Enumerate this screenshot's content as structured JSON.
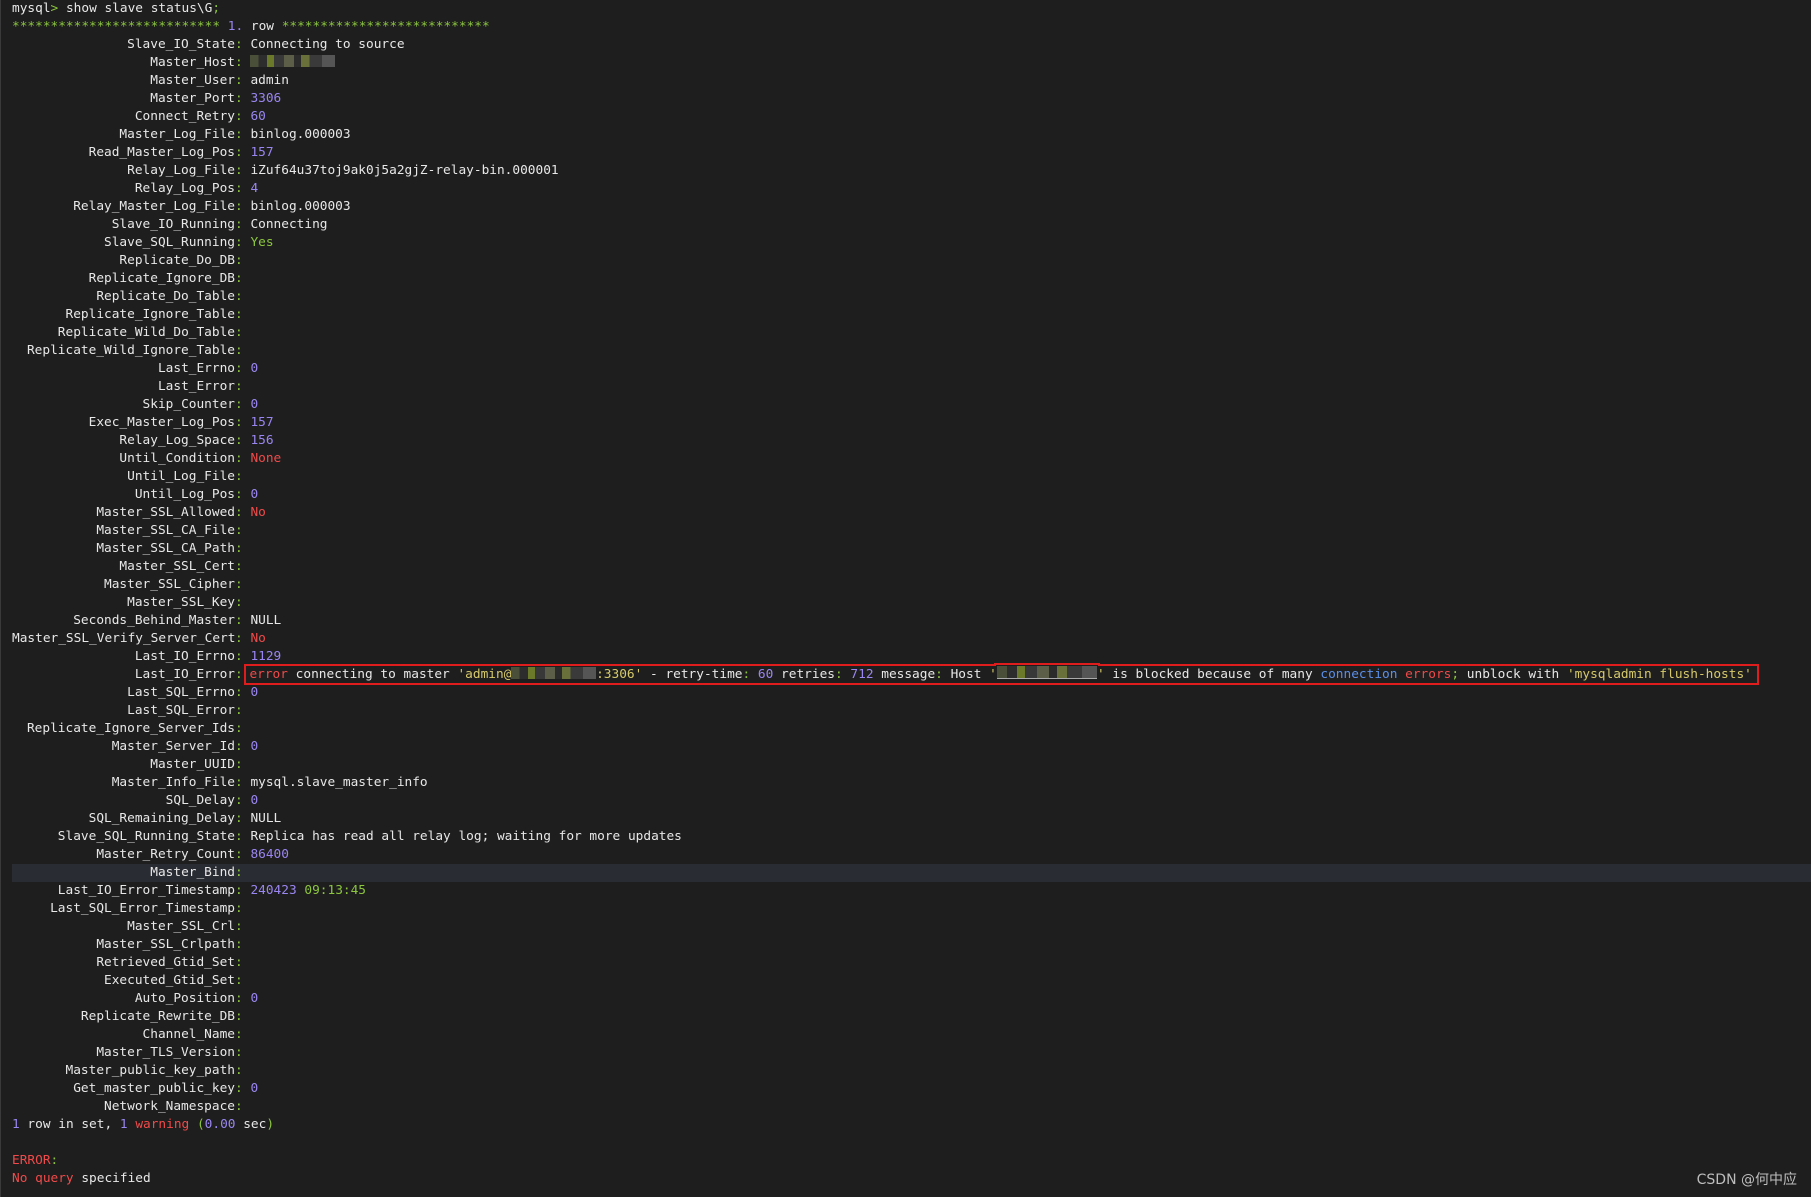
{
  "colors": {
    "background": "#1e1e1e",
    "text": "#e8e8e8",
    "number": "#9a86f0",
    "punct": "#8cc63f",
    "red": "#f04a4a",
    "string": "#d6c96a",
    "blue": "#5b8fe8",
    "error_box": "#e01d1d"
  },
  "prompt": [
    {
      "t": "mysql",
      "c": "w"
    },
    {
      "t": ">",
      "c": "g"
    },
    {
      "t": " show slave status\\G",
      "c": "w"
    },
    {
      "t": ";",
      "c": "g"
    }
  ],
  "row_header": [
    {
      "t": "***************************",
      "c": "g"
    },
    {
      "t": " 1.",
      "c": "n"
    },
    {
      "t": " row ",
      "c": "w"
    },
    {
      "t": "***************************",
      "c": "g"
    }
  ],
  "fields": [
    {
      "k": "Slave_IO_State",
      "v": [
        {
          "t": "Connecting to source",
          "c": "w"
        }
      ]
    },
    {
      "k": "Master_Host",
      "v": [
        {
          "mask": 11
        }
      ]
    },
    {
      "k": "Master_User",
      "v": [
        {
          "t": "admin",
          "c": "w"
        }
      ]
    },
    {
      "k": "Master_Port",
      "v": [
        {
          "t": "3306",
          "c": "n"
        }
      ]
    },
    {
      "k": "Connect_Retry",
      "v": [
        {
          "t": "60",
          "c": "n"
        }
      ]
    },
    {
      "k": "Master_Log_File",
      "v": [
        {
          "t": "binlog.000003",
          "c": "w"
        }
      ]
    },
    {
      "k": "Read_Master_Log_Pos",
      "v": [
        {
          "t": "157",
          "c": "n"
        }
      ]
    },
    {
      "k": "Relay_Log_File",
      "v": [
        {
          "t": "iZuf64u37toj9ak0j5a2gjZ-relay-bin.000001",
          "c": "w"
        }
      ]
    },
    {
      "k": "Relay_Log_Pos",
      "v": [
        {
          "t": "4",
          "c": "n"
        }
      ]
    },
    {
      "k": "Relay_Master_Log_File",
      "v": [
        {
          "t": "binlog.000003",
          "c": "w"
        }
      ]
    },
    {
      "k": "Slave_IO_Running",
      "v": [
        {
          "t": "Connecting",
          "c": "w"
        }
      ]
    },
    {
      "k": "Slave_SQL_Running",
      "v": [
        {
          "t": "Yes",
          "c": "g"
        }
      ]
    },
    {
      "k": "Replicate_Do_DB",
      "v": []
    },
    {
      "k": "Replicate_Ignore_DB",
      "v": []
    },
    {
      "k": "Replicate_Do_Table",
      "v": []
    },
    {
      "k": "Replicate_Ignore_Table",
      "v": []
    },
    {
      "k": "Replicate_Wild_Do_Table",
      "v": []
    },
    {
      "k": "Replicate_Wild_Ignore_Table",
      "v": []
    },
    {
      "k": "Last_Errno",
      "v": [
        {
          "t": "0",
          "c": "n"
        }
      ]
    },
    {
      "k": "Last_Error",
      "v": []
    },
    {
      "k": "Skip_Counter",
      "v": [
        {
          "t": "0",
          "c": "n"
        }
      ]
    },
    {
      "k": "Exec_Master_Log_Pos",
      "v": [
        {
          "t": "157",
          "c": "n"
        }
      ]
    },
    {
      "k": "Relay_Log_Space",
      "v": [
        {
          "t": "156",
          "c": "n"
        }
      ]
    },
    {
      "k": "Until_Condition",
      "v": [
        {
          "t": "None",
          "c": "r"
        }
      ]
    },
    {
      "k": "Until_Log_File",
      "v": []
    },
    {
      "k": "Until_Log_Pos",
      "v": [
        {
          "t": "0",
          "c": "n"
        }
      ]
    },
    {
      "k": "Master_SSL_Allowed",
      "v": [
        {
          "t": "No",
          "c": "r"
        }
      ]
    },
    {
      "k": "Master_SSL_CA_File",
      "v": []
    },
    {
      "k": "Master_SSL_CA_Path",
      "v": []
    },
    {
      "k": "Master_SSL_Cert",
      "v": []
    },
    {
      "k": "Master_SSL_Cipher",
      "v": []
    },
    {
      "k": "Master_SSL_Key",
      "v": []
    },
    {
      "k": "Seconds_Behind_Master",
      "v": [
        {
          "t": "NULL",
          "c": "w"
        }
      ]
    },
    {
      "k": "Master_SSL_Verify_Server_Cert",
      "v": [
        {
          "t": "No",
          "c": "r"
        }
      ]
    },
    {
      "k": "Last_IO_Errno",
      "v": [
        {
          "t": "1129",
          "c": "n"
        }
      ]
    },
    {
      "k": "Last_IO_Error",
      "boxed": true,
      "v": [
        {
          "t": "error",
          "c": "r"
        },
        {
          "t": " connecting to master ",
          "c": "w"
        },
        {
          "t": "'admin@",
          "c": "y"
        },
        {
          "mask": 11
        },
        {
          "t": ":3306'",
          "c": "y"
        },
        {
          "t": " - retry-time",
          "c": "w"
        },
        {
          "t": ":",
          "c": "g"
        },
        {
          "t": " 60",
          "c": "n"
        },
        {
          "t": " retries",
          "c": "w"
        },
        {
          "t": ":",
          "c": "g"
        },
        {
          "t": " 712",
          "c": "n"
        },
        {
          "t": " message",
          "c": "w"
        },
        {
          "t": ":",
          "c": "g"
        },
        {
          "t": " Host ",
          "c": "w"
        },
        {
          "t": "'",
          "c": "y"
        },
        {
          "mask": 13,
          "underline": true
        },
        {
          "t": "'",
          "c": "y"
        },
        {
          "t": " is blocked because of many ",
          "c": "w"
        },
        {
          "t": "connection",
          "c": "b"
        },
        {
          "t": " errors",
          "c": "r"
        },
        {
          "t": ";",
          "c": "g"
        },
        {
          "t": " unblock with ",
          "c": "w"
        },
        {
          "t": "'mysqladmin flush-hosts'",
          "c": "y"
        }
      ]
    },
    {
      "k": "Last_SQL_Errno",
      "v": [
        {
          "t": "0",
          "c": "n"
        }
      ]
    },
    {
      "k": "Last_SQL_Error",
      "v": []
    },
    {
      "k": "Replicate_Ignore_Server_Ids",
      "v": []
    },
    {
      "k": "Master_Server_Id",
      "v": [
        {
          "t": "0",
          "c": "n"
        }
      ]
    },
    {
      "k": "Master_UUID",
      "v": []
    },
    {
      "k": "Master_Info_File",
      "v": [
        {
          "t": "mysql.slave_master_info",
          "c": "w"
        }
      ]
    },
    {
      "k": "SQL_Delay",
      "v": [
        {
          "t": "0",
          "c": "n"
        }
      ]
    },
    {
      "k": "SQL_Remaining_Delay",
      "v": [
        {
          "t": "NULL",
          "c": "w"
        }
      ]
    },
    {
      "k": "Slave_SQL_Running_State",
      "v": [
        {
          "t": "Replica has read all relay log; waiting for more updates",
          "c": "w"
        }
      ]
    },
    {
      "k": "Master_Retry_Count",
      "v": [
        {
          "t": "86400",
          "c": "n"
        }
      ]
    },
    {
      "k": "Master_Bind",
      "v": [],
      "highlight": true
    },
    {
      "k": "Last_IO_Error_Timestamp",
      "v": [
        {
          "t": "240423",
          "c": "n"
        },
        {
          "t": " 09:13:45",
          "c": "g"
        }
      ]
    },
    {
      "k": "Last_SQL_Error_Timestamp",
      "v": []
    },
    {
      "k": "Master_SSL_Crl",
      "v": []
    },
    {
      "k": "Master_SSL_Crlpath",
      "v": []
    },
    {
      "k": "Retrieved_Gtid_Set",
      "v": []
    },
    {
      "k": "Executed_Gtid_Set",
      "v": []
    },
    {
      "k": "Auto_Position",
      "v": [
        {
          "t": "0",
          "c": "n"
        }
      ]
    },
    {
      "k": "Replicate_Rewrite_DB",
      "v": []
    },
    {
      "k": "Channel_Name",
      "v": []
    },
    {
      "k": "Master_TLS_Version",
      "v": []
    },
    {
      "k": "Master_public_key_path",
      "v": []
    },
    {
      "k": "Get_master_public_key",
      "v": [
        {
          "t": "0",
          "c": "n"
        }
      ]
    },
    {
      "k": "Network_Namespace",
      "v": []
    }
  ],
  "summary": [
    {
      "t": "1",
      "c": "n"
    },
    {
      "t": " row in set, ",
      "c": "w"
    },
    {
      "t": "1",
      "c": "n"
    },
    {
      "t": " warning",
      "c": "r"
    },
    {
      "t": " (",
      "c": "g"
    },
    {
      "t": "0.00",
      "c": "n"
    },
    {
      "t": " sec",
      "c": "w"
    },
    {
      "t": ")",
      "c": "g"
    }
  ],
  "error_line1": [
    {
      "t": "ERROR",
      "c": "r"
    },
    {
      "t": ":",
      "c": "g"
    }
  ],
  "error_line2": [
    {
      "t": "No query",
      "c": "r"
    },
    {
      "t": " specified",
      "c": "w"
    }
  ],
  "watermark": "CSDN @何中应"
}
